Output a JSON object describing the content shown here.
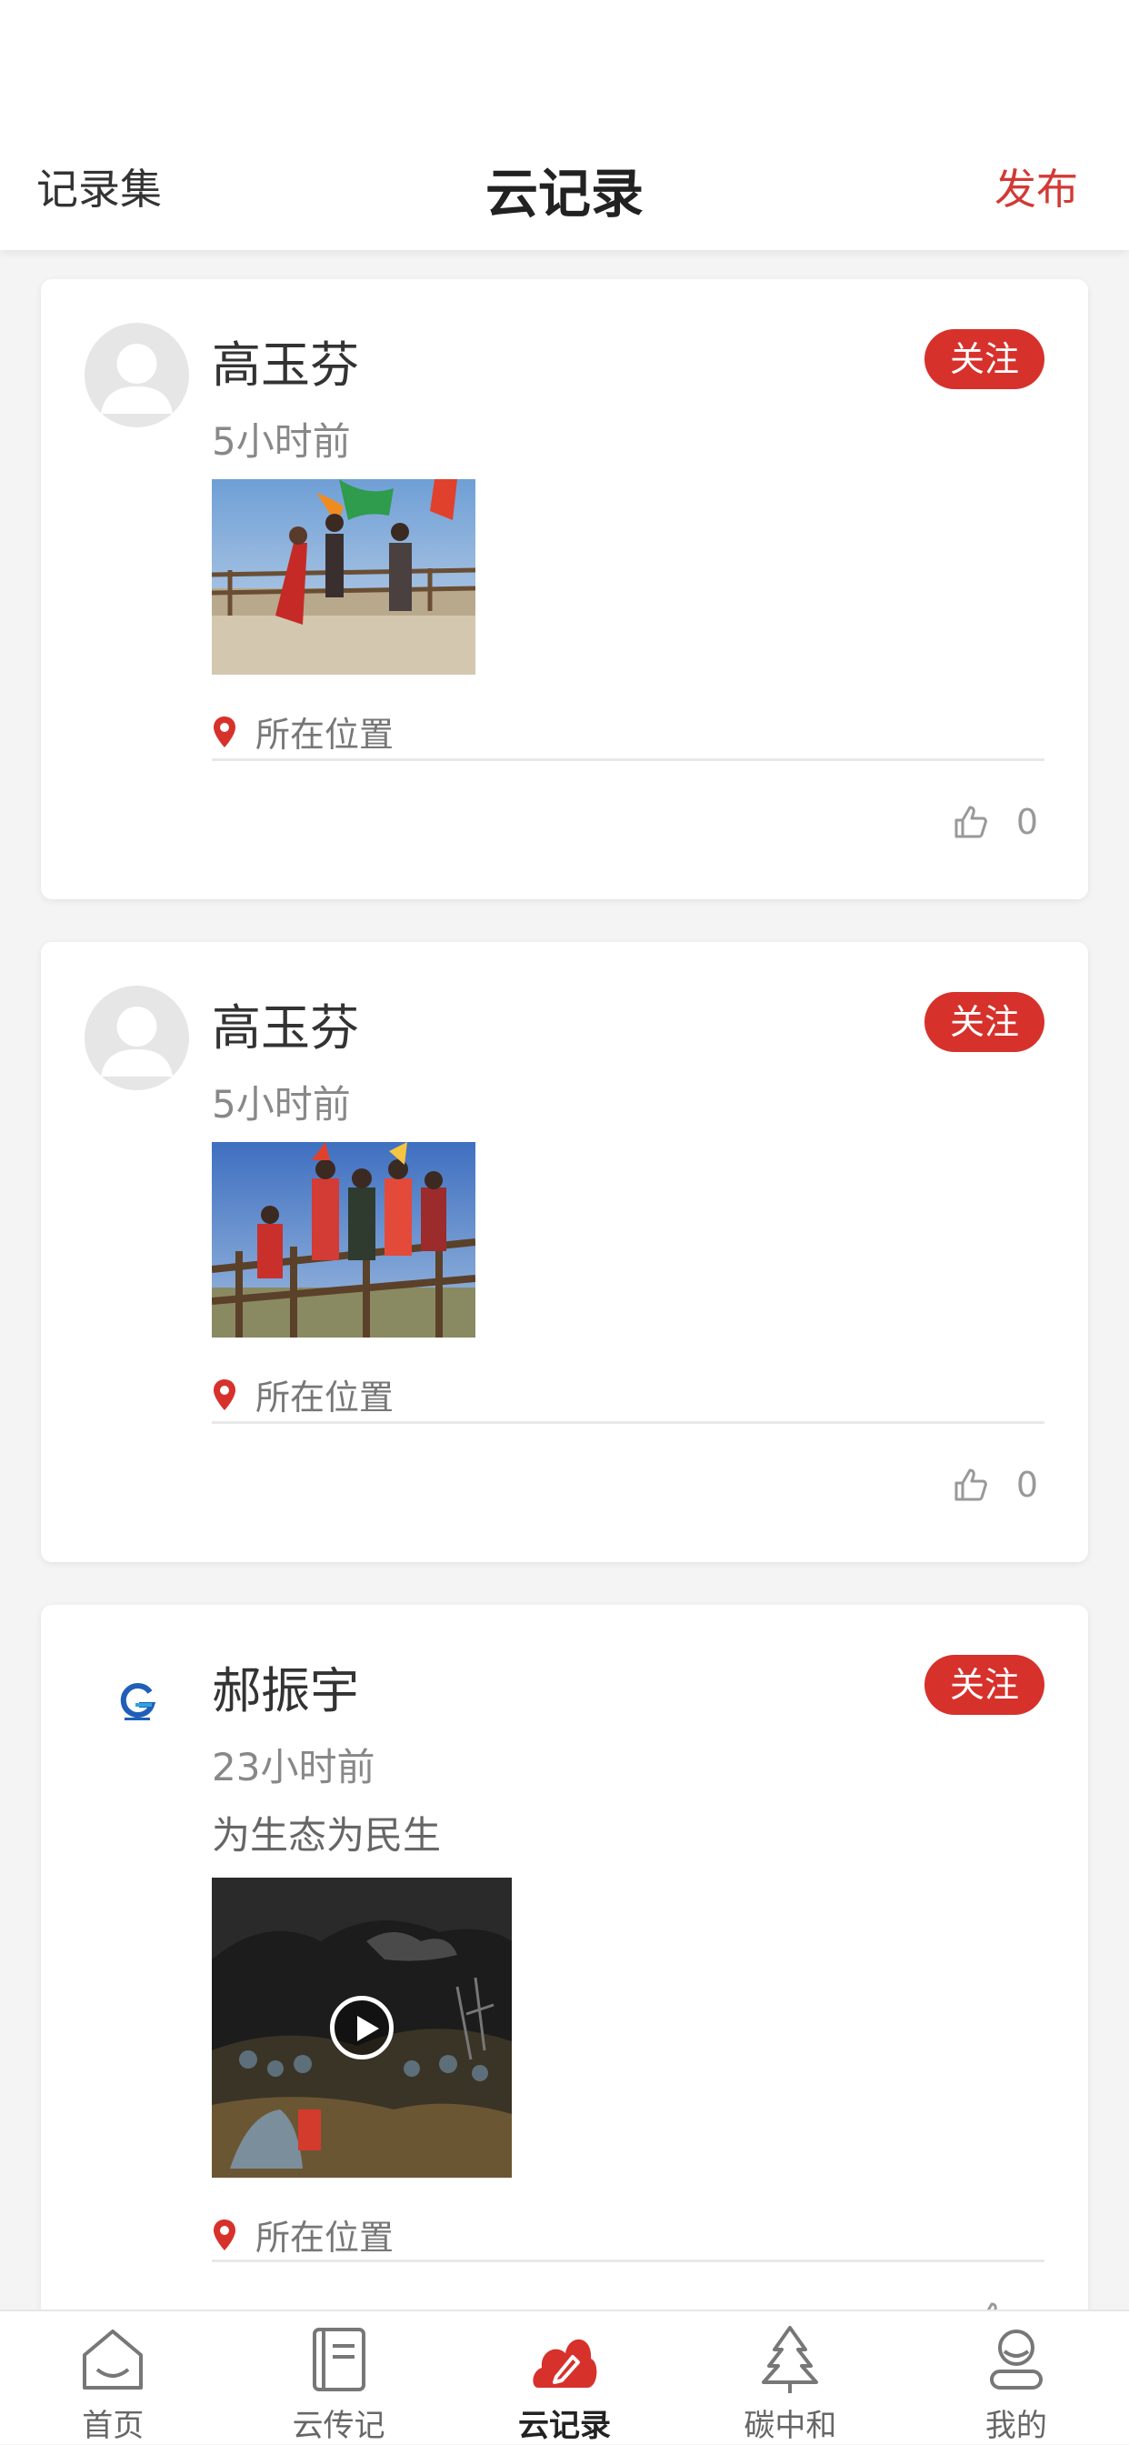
{
  "header": {
    "left_label": "记录集",
    "title": "云记录",
    "right_label": "发布"
  },
  "posts": [
    {
      "author": "高玉芬",
      "time": "5小时前",
      "description": "",
      "follow_label": "关注",
      "location": "所在位置",
      "likes": "0",
      "media_type": "image"
    },
    {
      "author": "高玉芬",
      "time": "5小时前",
      "description": "",
      "follow_label": "关注",
      "location": "所在位置",
      "likes": "0",
      "media_type": "image"
    },
    {
      "author": "郝振宇",
      "time": "23小时前",
      "description": "为生态为民生",
      "follow_label": "关注",
      "location": "所在位置",
      "likes": "",
      "media_type": "video"
    }
  ],
  "tabbar": {
    "items": [
      {
        "label": "首页",
        "icon": "home-icon"
      },
      {
        "label": "云传记",
        "icon": "book-icon"
      },
      {
        "label": "云记录",
        "icon": "cloud-record-icon",
        "active": true
      },
      {
        "label": "碳中和",
        "icon": "tree-icon"
      },
      {
        "label": "我的",
        "icon": "profile-icon"
      }
    ]
  },
  "colors": {
    "accent": "#d7312c",
    "background": "#f4f4f4",
    "card": "#ffffff"
  }
}
